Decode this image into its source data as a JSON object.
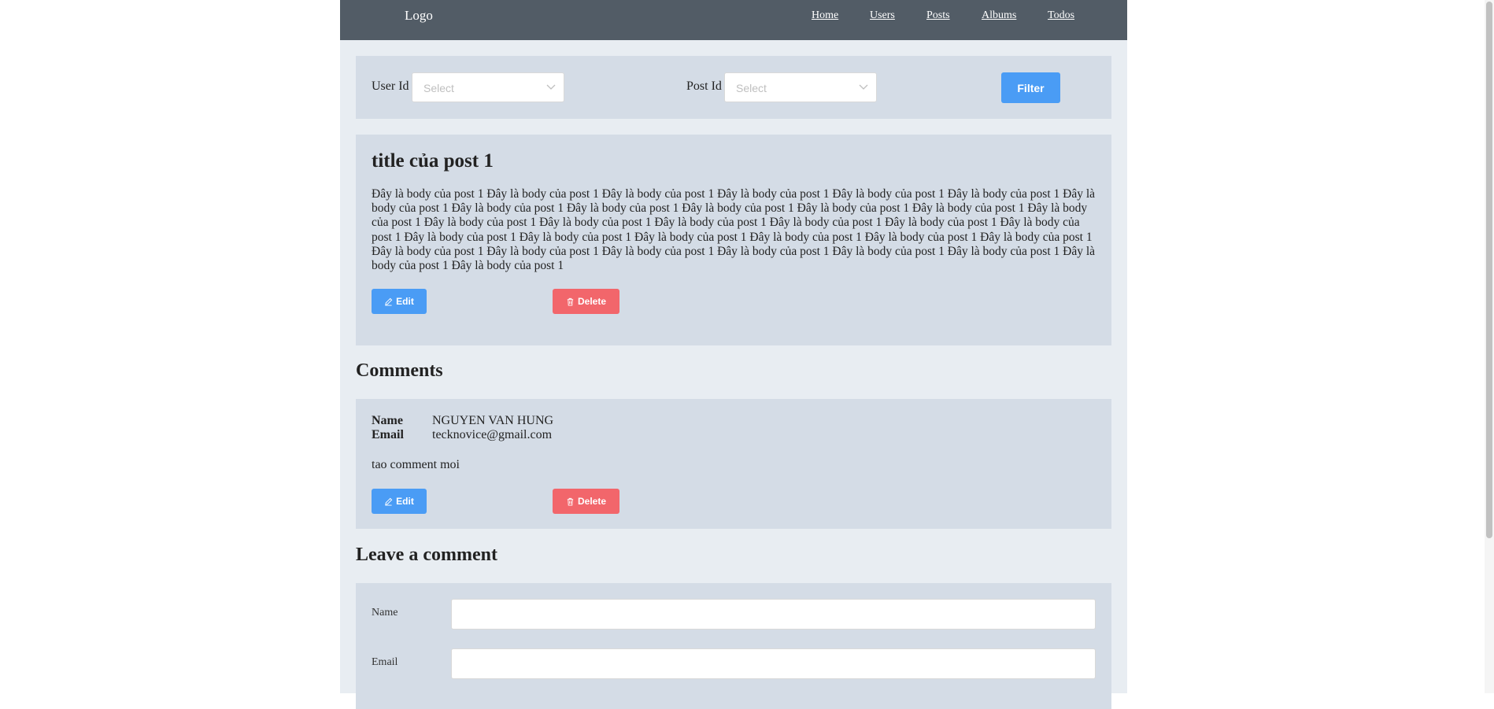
{
  "header": {
    "logo": "Logo",
    "nav": [
      {
        "label": "Home"
      },
      {
        "label": "Users"
      },
      {
        "label": "Posts"
      },
      {
        "label": "Albums"
      },
      {
        "label": "Todos"
      }
    ]
  },
  "filter": {
    "user_id_label": "User Id",
    "user_id_placeholder": "Select",
    "post_id_label": "Post Id",
    "post_id_placeholder": "Select",
    "filter_label": "Filter"
  },
  "post": {
    "title": "title của post 1",
    "body": "Đây là body của post 1 Đây là body của post 1 Đây là body của post 1 Đây là body của post 1 Đây là body của post 1 Đây là body của post 1 Đây là body của post 1 Đây là body của post 1 Đây là body của post 1 Đây là body của post 1 Đây là body của post 1 Đây là body của post 1 Đây là body của post 1 Đây là body của post 1 Đây là body của post 1 Đây là body của post 1 Đây là body của post 1 Đây là body của post 1 Đây là body của post 1 Đây là body của post 1 Đây là body của post 1 Đây là body của post 1 Đây là body của post 1 Đây là body của post 1 Đây là body của post 1 Đây là body của post 1 Đây là body của post 1 Đây là body của post 1 Đây là body của post 1 Đây là body của post 1 Đây là body của post 1 Đây là body của post 1 Đây là body của post 1",
    "edit_label": "Edit",
    "delete_label": "Delete"
  },
  "comments": {
    "heading": "Comments",
    "items": [
      {
        "name_key": "Name",
        "name": "NGUYEN VAN HUNG",
        "email_key": "Email",
        "email": "tecknovice@gmail.com",
        "body": "tao comment moi",
        "edit_label": "Edit",
        "delete_label": "Delete"
      }
    ]
  },
  "leave_comment": {
    "heading": "Leave a comment",
    "name_label": "Name",
    "name_value": "",
    "email_label": "Email",
    "email_value": ""
  },
  "colors": {
    "topbar": "#525c66",
    "page_bg": "#e8edf2",
    "panel_bg": "#d4dce6",
    "primary": "#4a9cf5",
    "danger": "#f2666b"
  }
}
